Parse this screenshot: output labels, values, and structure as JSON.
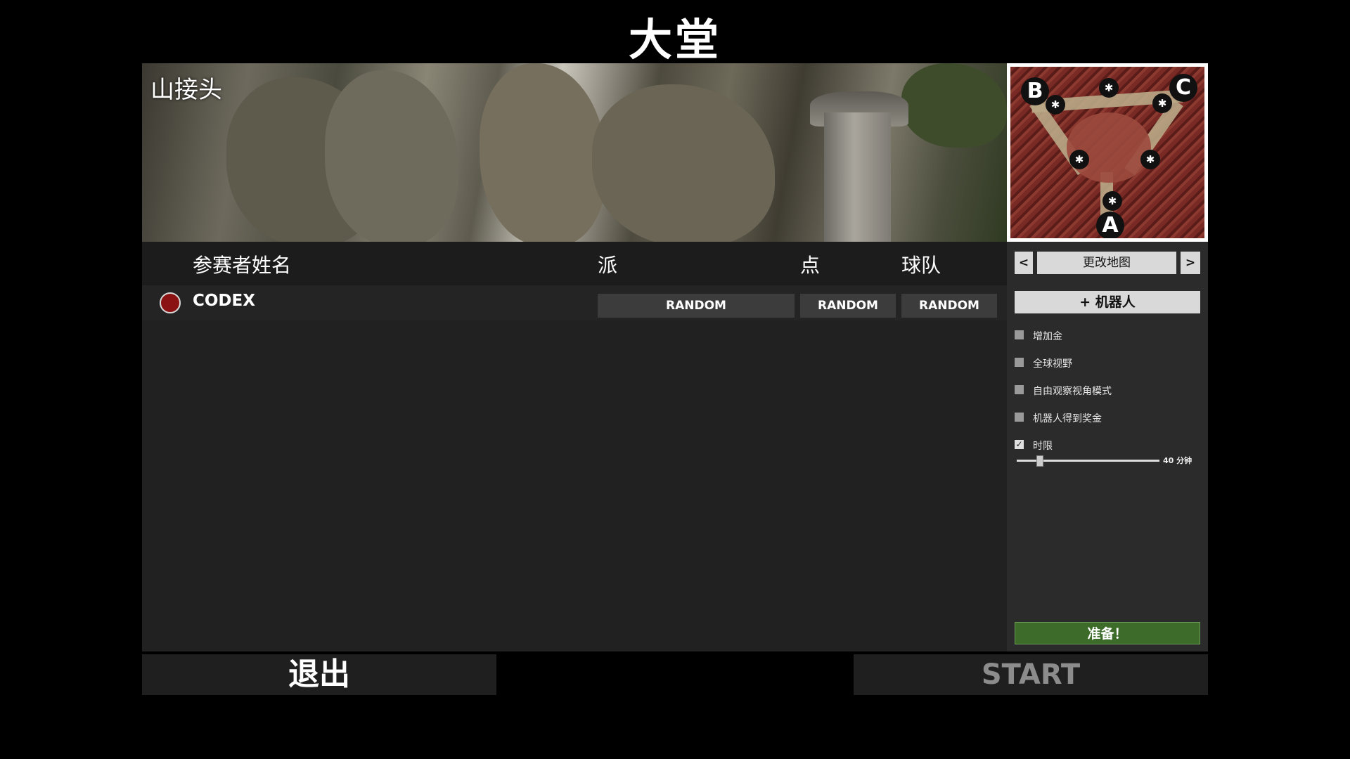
{
  "page": {
    "title": "大堂"
  },
  "map": {
    "name": "山接头",
    "markers": [
      "B",
      "C",
      "A"
    ]
  },
  "players": {
    "headers": {
      "name": "参赛者姓名",
      "faction": "派",
      "spawn": "点",
      "team": "球队"
    },
    "rows": [
      {
        "name": "CODEX",
        "faction": "RANDOM",
        "spawn": "RANDOM",
        "team": "RANDOM",
        "color": "#8a1212"
      }
    ]
  },
  "sidebar": {
    "prev": "<",
    "change_map": "更改地图",
    "next": ">",
    "add_bot": "+ 机器人",
    "options": [
      {
        "label": "增加金",
        "checked": false
      },
      {
        "label": "全球视野",
        "checked": false
      },
      {
        "label": "自由观察视角模式",
        "checked": false
      },
      {
        "label": "机器人得到奖金",
        "checked": false
      },
      {
        "label": "时限",
        "checked": true
      }
    ],
    "time_limit": {
      "value": 40,
      "unit": "分钟",
      "display": "40 分钟"
    },
    "ready": "准备！"
  },
  "footer": {
    "exit": "退出",
    "start": "START"
  }
}
